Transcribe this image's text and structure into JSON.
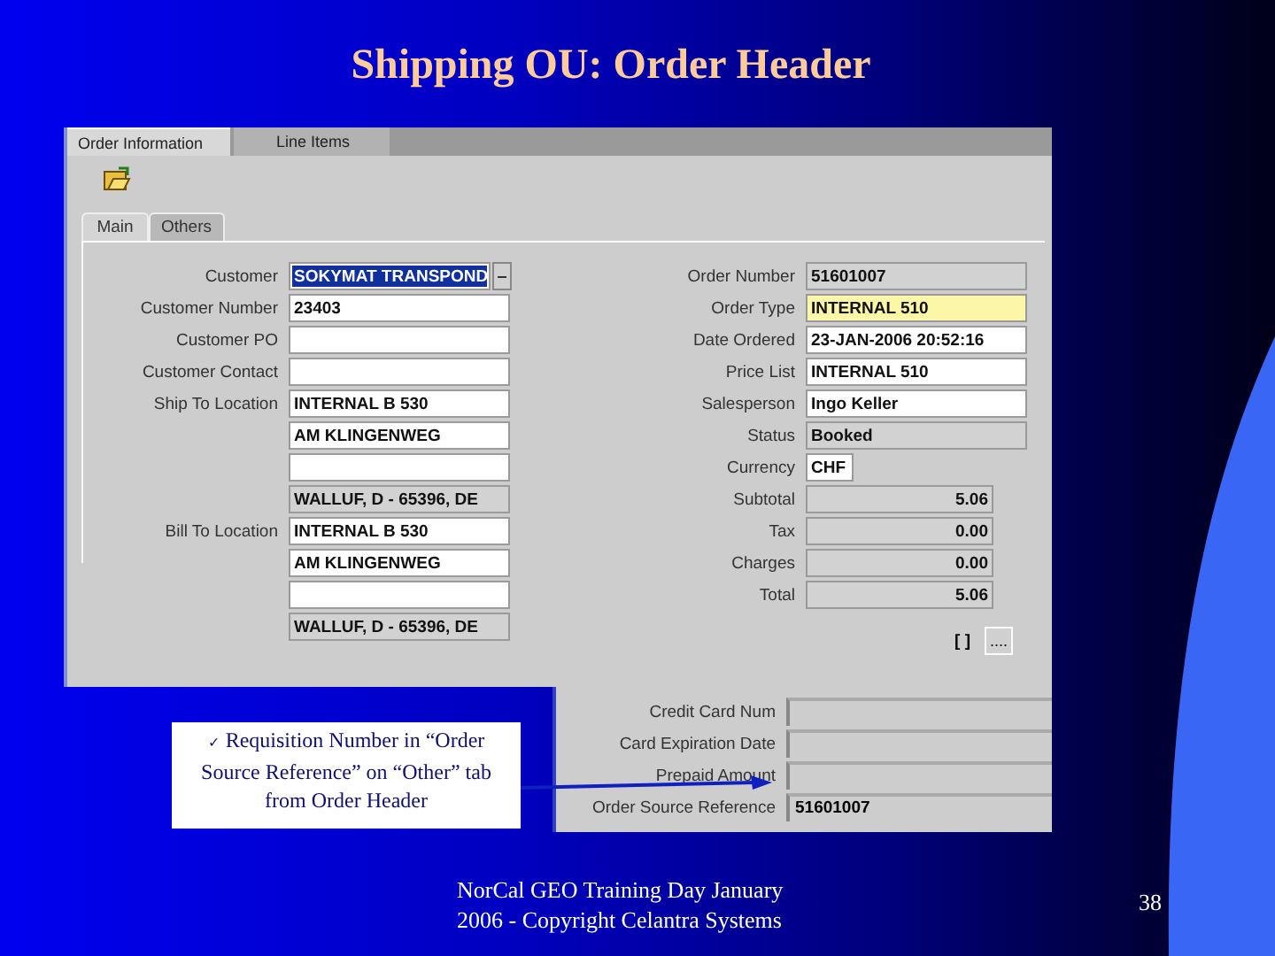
{
  "slide": {
    "title": "Shipping OU: Order Header",
    "page_number": "38",
    "footer_lines": [
      "NorCal GEO Training Day January",
      "2006 -  Copyright Celantra Systems"
    ]
  },
  "window": {
    "tabs": [
      {
        "label": "Order Information",
        "selected": true
      },
      {
        "label": "Line Items",
        "selected": false
      }
    ],
    "subtabs": [
      {
        "label": "Main",
        "selected": true
      },
      {
        "label": "Others",
        "selected": false
      }
    ],
    "left_fields": [
      {
        "label": "Customer",
        "lov": true,
        "values": [
          {
            "text": "SOKYMAT TRANSPOND",
            "kind": "selected"
          }
        ]
      },
      {
        "label": "Customer Number",
        "lov": false,
        "values": [
          {
            "text": "23403",
            "kind": "editable"
          }
        ]
      },
      {
        "label": "Customer PO",
        "lov": false,
        "values": [
          {
            "kind": "editable"
          }
        ]
      },
      {
        "label": "Customer Contact",
        "lov": false,
        "values": [
          {
            "kind": "editable"
          }
        ]
      },
      {
        "label": "Ship To Location",
        "lov": false,
        "values": [
          {
            "text": "INTERNAL B 530",
            "kind": "editable"
          },
          {
            "text": "AM KLINGENWEG",
            "kind": "editable"
          },
          {
            "kind": "editable"
          },
          {
            "text": "WALLUF, D - 65396, DE",
            "kind": "readonly"
          }
        ]
      },
      {
        "label": "Bill To Location",
        "lov": false,
        "values": [
          {
            "text": "INTERNAL B 530",
            "kind": "editable"
          },
          {
            "text": "AM KLINGENWEG",
            "kind": "editable"
          },
          {
            "kind": "editable"
          },
          {
            "text": "WALLUF, D - 65396, DE",
            "kind": "readonly"
          }
        ]
      }
    ],
    "right_fields": [
      {
        "label": "Order Number",
        "text": "51601007",
        "kind": "readonly"
      },
      {
        "label": "Order Type",
        "text": "INTERNAL 510",
        "kind": "required"
      },
      {
        "label": "Date Ordered",
        "text": "23-JAN-2006 20:52:16",
        "kind": "editable"
      },
      {
        "label": "Price List",
        "text": "INTERNAL 510",
        "kind": "editable"
      },
      {
        "label": "Salesperson",
        "text": "Ingo Keller",
        "kind": "editable"
      },
      {
        "label": "Status",
        "text": "Booked",
        "kind": "readonly"
      },
      {
        "label": "Currency",
        "text": "CHF",
        "kind": "short"
      },
      {
        "label": "Subtotal",
        "text": "5.06",
        "kind": "amount"
      },
      {
        "label": "Tax",
        "text": "0.00",
        "kind": "amount"
      },
      {
        "label": "Charges",
        "text": "0.00",
        "kind": "amount"
      },
      {
        "label": "Total",
        "text": "5.06",
        "kind": "amount"
      }
    ],
    "flag_text": "[ ]",
    "more_button": "....",
    "other_fields": [
      {
        "label": "Credit Card Num"
      },
      {
        "label": "Card Expiration Date"
      },
      {
        "label": "Prepaid Amount"
      },
      {
        "label": "Order Source Reference",
        "text": "51601007"
      }
    ]
  },
  "callout": {
    "bullet": "✓",
    "text": "Requisition Number in “Order Source Reference” on “Other” tab from Order Header"
  }
}
